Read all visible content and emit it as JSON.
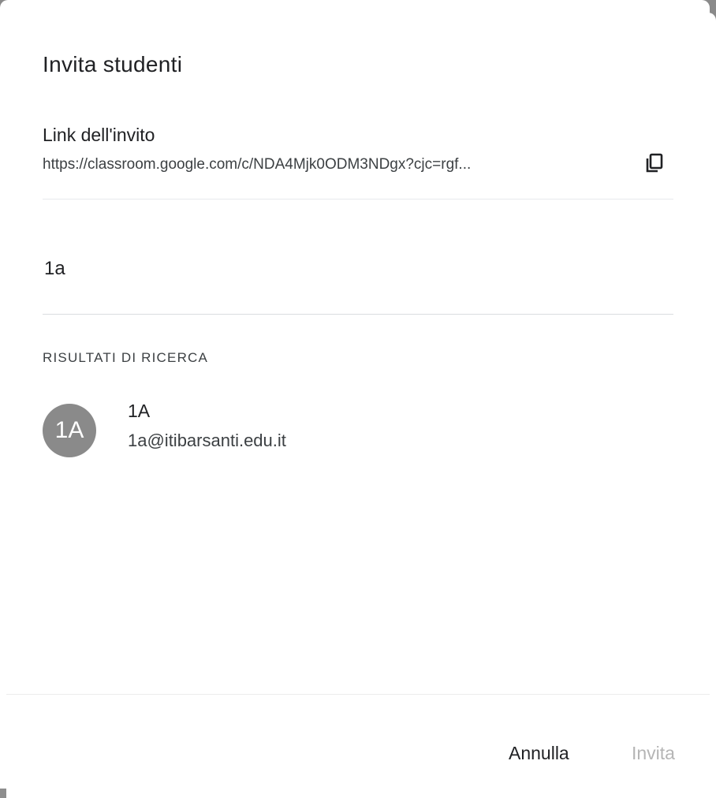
{
  "dialog": {
    "title": "Invita studenti"
  },
  "invite_link": {
    "heading": "Link dell'invito",
    "url": "https://classroom.google.com/c/NDA4Mjk0ODM3NDgx?cjc=rgf...",
    "copy_icon": "copy-icon"
  },
  "search": {
    "value": "1a"
  },
  "results": {
    "heading": "RISULTATI DI RICERCA",
    "items": [
      {
        "avatar_initials": "1A",
        "name": "1A",
        "email": "1a@itibarsanti.edu.it"
      }
    ]
  },
  "footer": {
    "cancel_label": "Annulla",
    "invite_label": "Invita"
  },
  "colors": {
    "avatar_bg": "#8a8a8a",
    "disabled_text": "#b5b5b5"
  }
}
